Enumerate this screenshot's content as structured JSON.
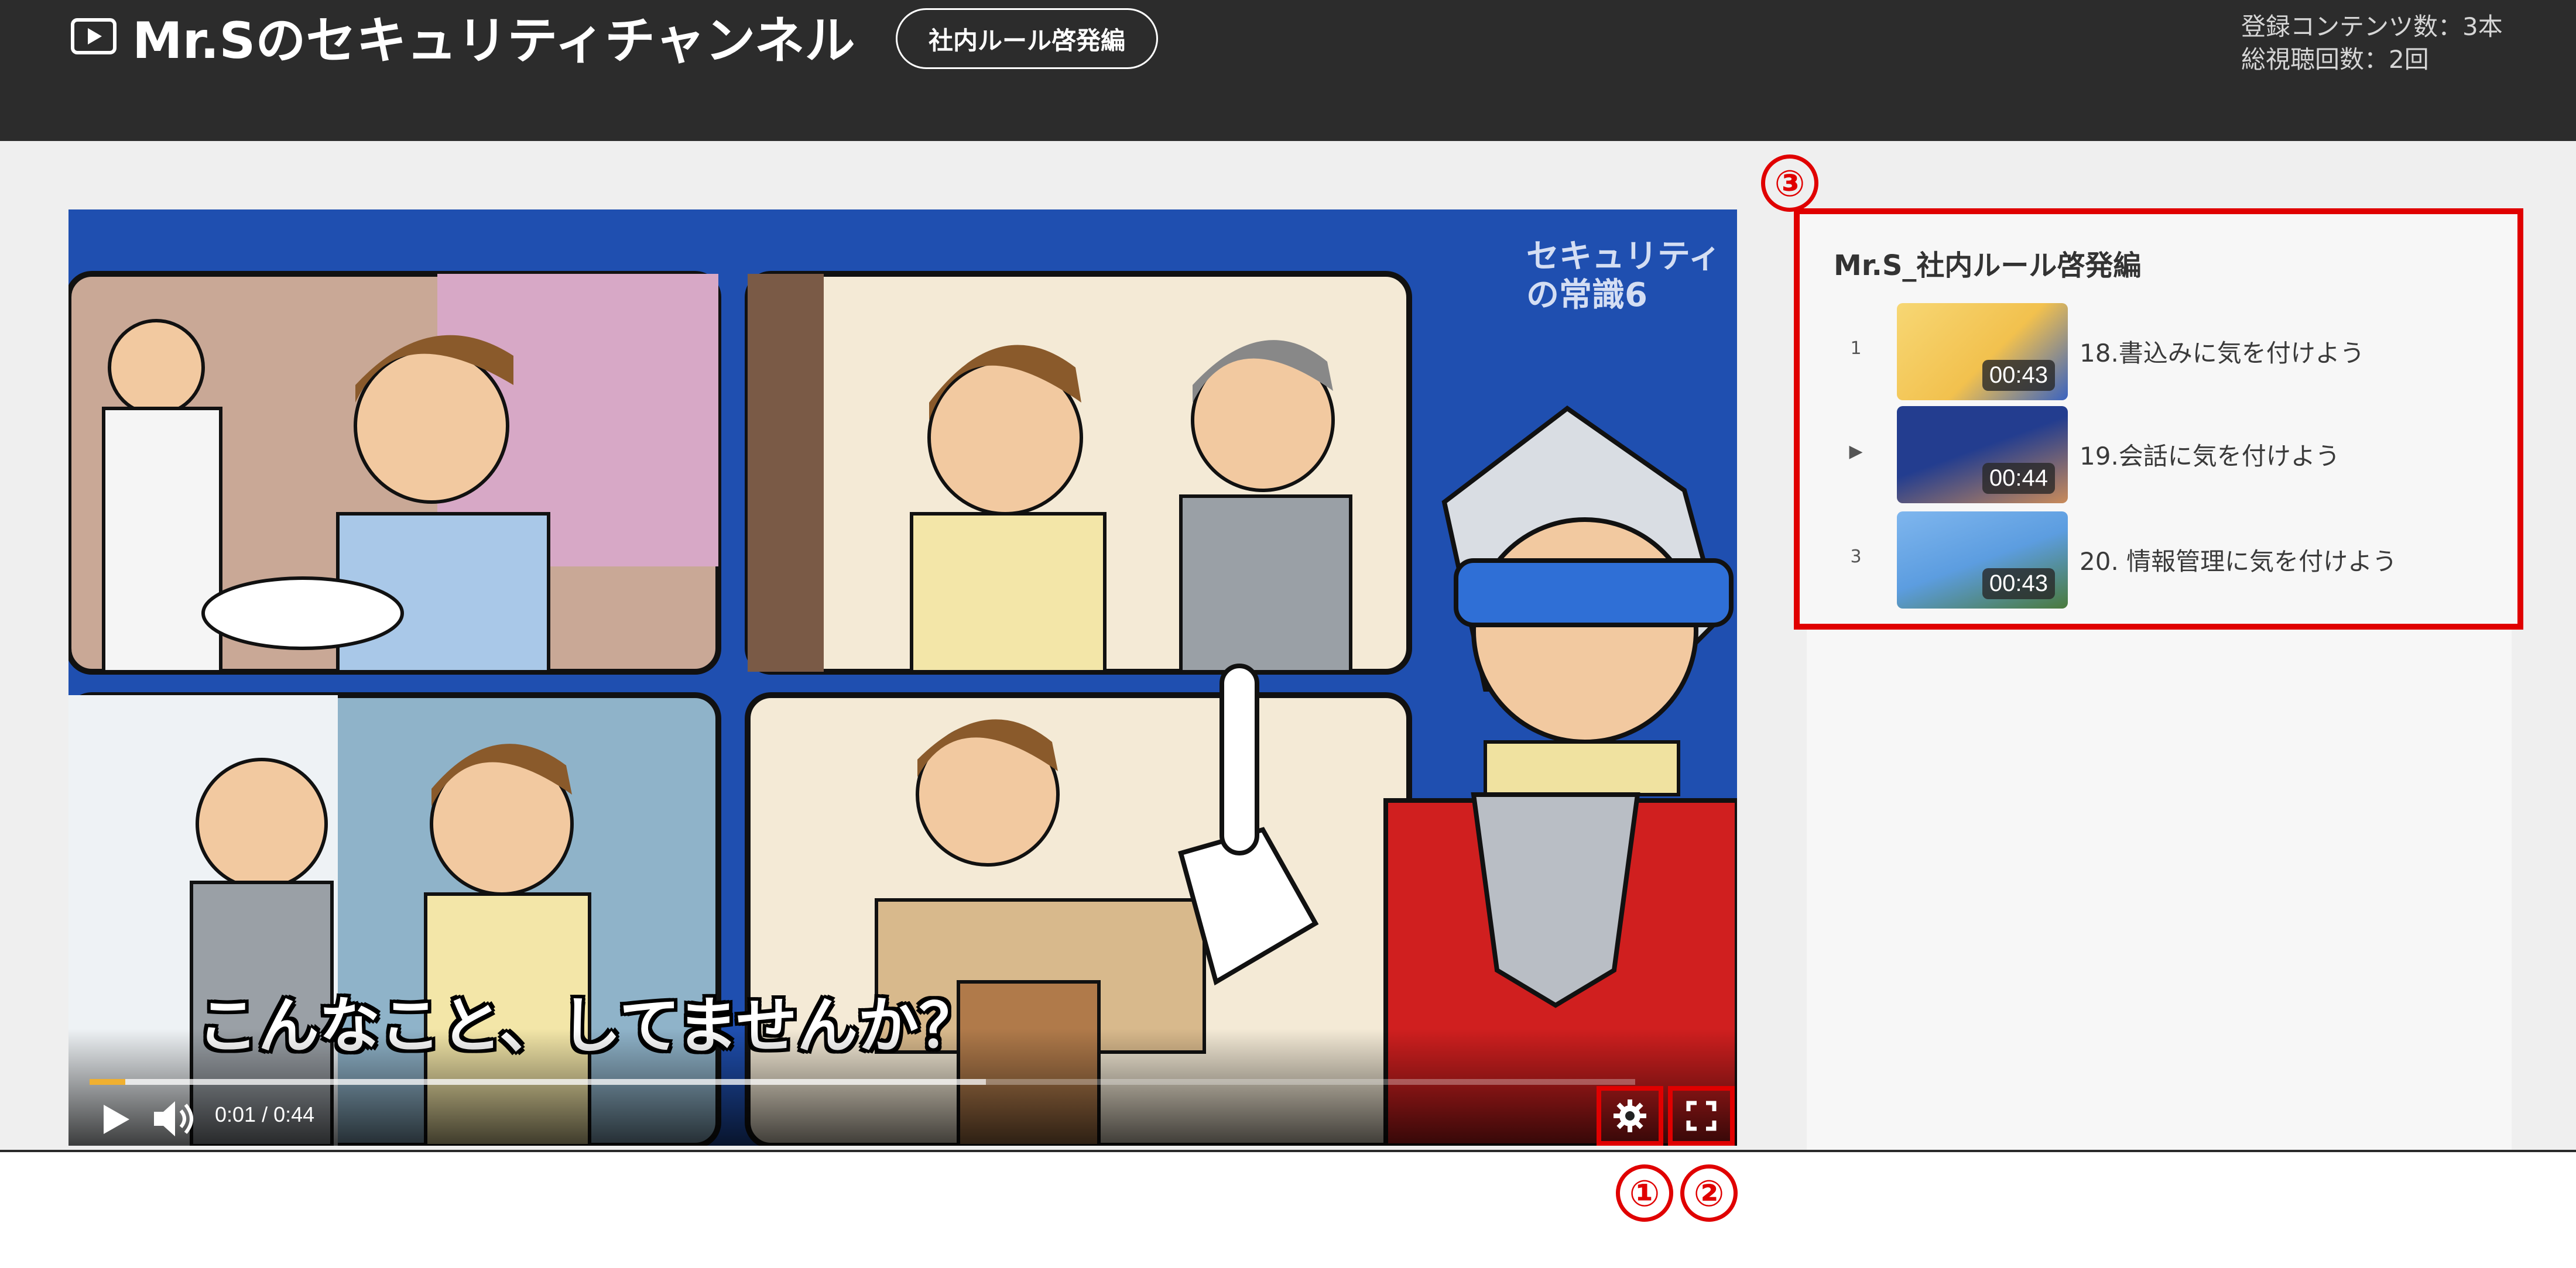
{
  "header": {
    "channel_title": "Mr.Sのセキュリティチャンネル",
    "series_badge": "社内ルール啓発編",
    "stats": {
      "content_count": "登録コンテンツ数：3本",
      "total_views": "総視聴回数：2回"
    }
  },
  "video": {
    "subtitle": "こんなこと、してませんか？",
    "watermark_line1": "セキュリティ",
    "watermark_line2": "の常識6",
    "time": "0:01 / 0:44",
    "progress_played_fraction": 0.023,
    "progress_buffered_fraction": 0.58,
    "icons": {
      "play": "play-icon",
      "volume": "volume-icon",
      "settings": "gear-icon",
      "fullscreen": "fullscreen-icon"
    }
  },
  "markers": {
    "m1": "①",
    "m2": "②",
    "m3": "③"
  },
  "playlist": {
    "title": "Mr.S_社内ルール啓発編",
    "items": [
      {
        "index": "1",
        "duration": "00:43",
        "label": "18.書込みに気を付けよう",
        "thumb_color": "#f2c14e"
      },
      {
        "index": "▶",
        "duration": "00:44",
        "label": "19.会話に気を付けよう",
        "thumb_color": "#233d8f"
      },
      {
        "index": "3",
        "duration": "00:43",
        "label": "20. 情報管理に気を付けよう",
        "thumb_color": "#5c9de0"
      }
    ]
  },
  "colors": {
    "header_bg": "#2c2c2c",
    "highlight_red": "#e00000",
    "progress_played": "#f0b030"
  }
}
